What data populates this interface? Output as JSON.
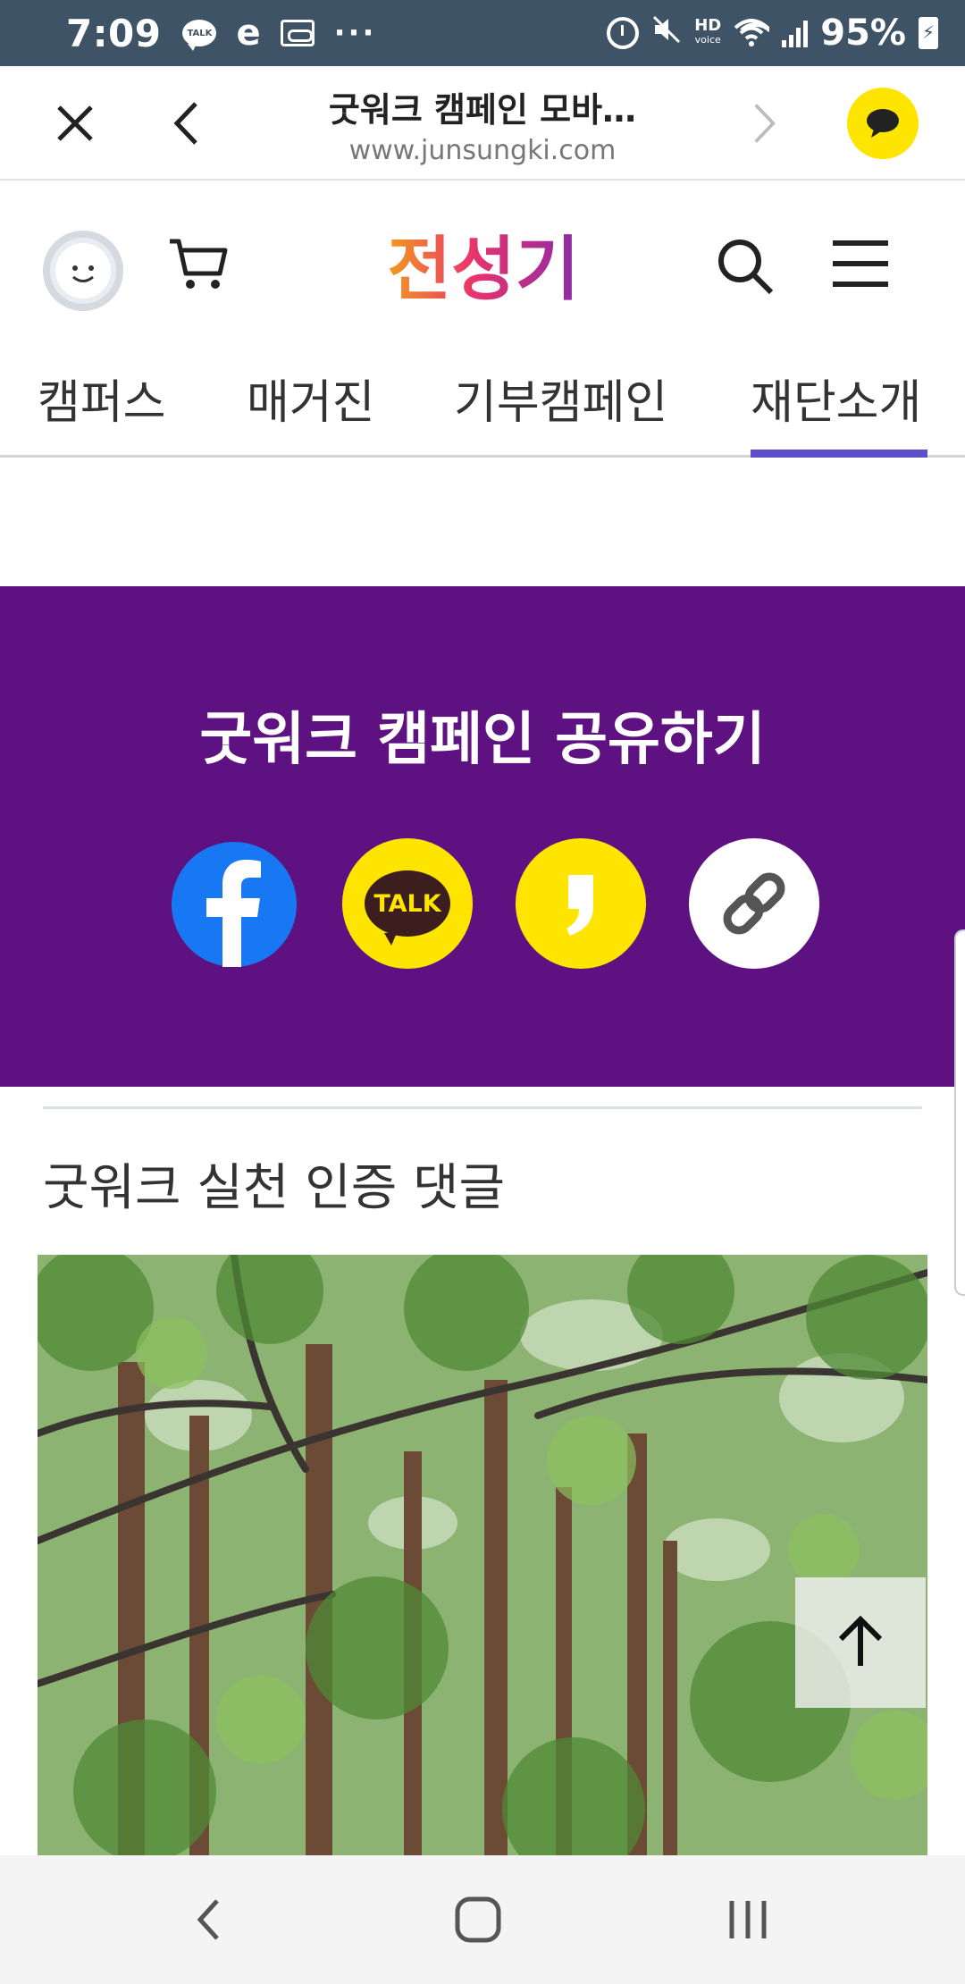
{
  "status_bar": {
    "time": "7:09",
    "talk_badge": "TALK",
    "e_icon": "e",
    "dots": "···",
    "hd": "HD",
    "hd_sub": "voice",
    "battery_percent": "95%"
  },
  "browser": {
    "title": "굿워크 캠페인 모바…",
    "url": "www.junsungki.com"
  },
  "site": {
    "logo_text": "전성기"
  },
  "tabs": [
    {
      "label": "캠퍼스",
      "active": false
    },
    {
      "label": "매거진",
      "active": false
    },
    {
      "label": "기부캠페인",
      "active": false
    },
    {
      "label": "재단소개",
      "active": true
    }
  ],
  "share": {
    "title": "굿워크 캠페인 공유하기",
    "kakao_talk_label": "TALK",
    "buttons": [
      "facebook-icon",
      "kakaotalk-icon",
      "kakaostory-icon",
      "link-icon"
    ]
  },
  "comments": {
    "heading": "굿워크 실천 인증 댓글"
  },
  "colors": {
    "status_bar": "#3e5466",
    "share_bg": "#5e1281",
    "tab_active": "#5b4fcc",
    "kakao_yellow": "#fee500",
    "facebook_blue": "#1877f2"
  }
}
